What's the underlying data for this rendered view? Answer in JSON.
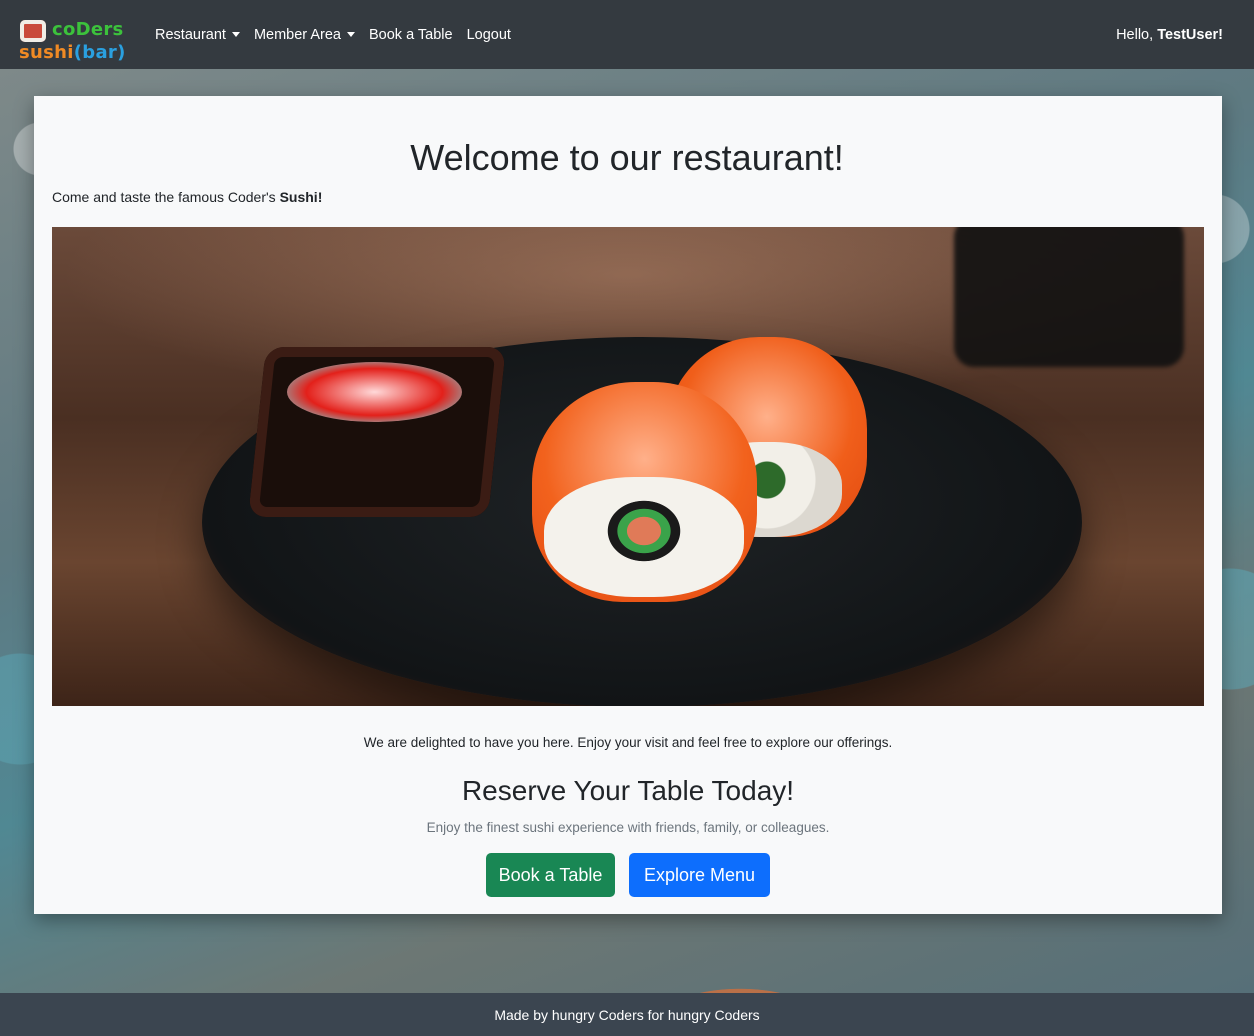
{
  "brand": {
    "line1": "coDers",
    "line2_word": "sushi",
    "line2_open": "(",
    "line2_bar": "bar",
    "line2_close": ")"
  },
  "nav": {
    "items": [
      {
        "label": "Restaurant",
        "dropdown": true
      },
      {
        "label": "Member Area",
        "dropdown": true
      },
      {
        "label": "Book a Table",
        "dropdown": false
      },
      {
        "label": "Logout",
        "dropdown": false
      }
    ],
    "greeting_prefix": "Hello, ",
    "username": "TestUser!"
  },
  "main": {
    "title": "Welcome to our restaurant!",
    "tagline_prefix": "Come and taste the famous Coder's ",
    "tagline_bold": "Sushi!",
    "intro": "We are delighted to have you here. Enjoy your visit and feel free to explore our offerings.",
    "reserve_title": "Reserve Your Table Today!",
    "reserve_subtitle": "Enjoy the finest sushi experience with friends, family, or colleagues.",
    "book_button": "Book a Table",
    "menu_button": "Explore Menu"
  },
  "footer": {
    "text": "Made by hungry Coders for hungry Coders"
  },
  "colors": {
    "navbar": "#343a40",
    "book_button": "#198754",
    "menu_button": "#0d6efd",
    "footer": "#3b4550"
  }
}
